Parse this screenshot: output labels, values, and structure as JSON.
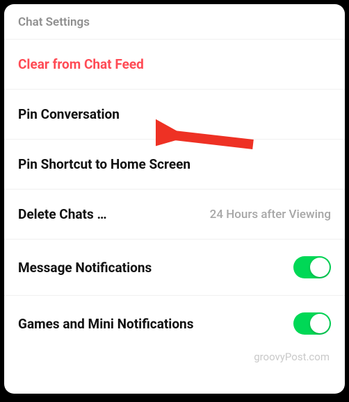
{
  "header": {
    "title": "Chat Settings"
  },
  "rows": {
    "clear": {
      "label": "Clear from Chat Feed"
    },
    "pin_conversation": {
      "label": "Pin Conversation"
    },
    "pin_shortcut": {
      "label": "Pin Shortcut to Home Screen"
    },
    "delete_chats": {
      "label": "Delete Chats …",
      "value": "24 Hours after Viewing"
    },
    "message_notifications": {
      "label": "Message Notifications",
      "toggle": true
    },
    "games_mini_notifications": {
      "label": "Games and Mini Notifications",
      "toggle": true
    }
  },
  "annotation": {
    "arrow_color": "#ee3124"
  },
  "watermark": "groovyPost.com"
}
